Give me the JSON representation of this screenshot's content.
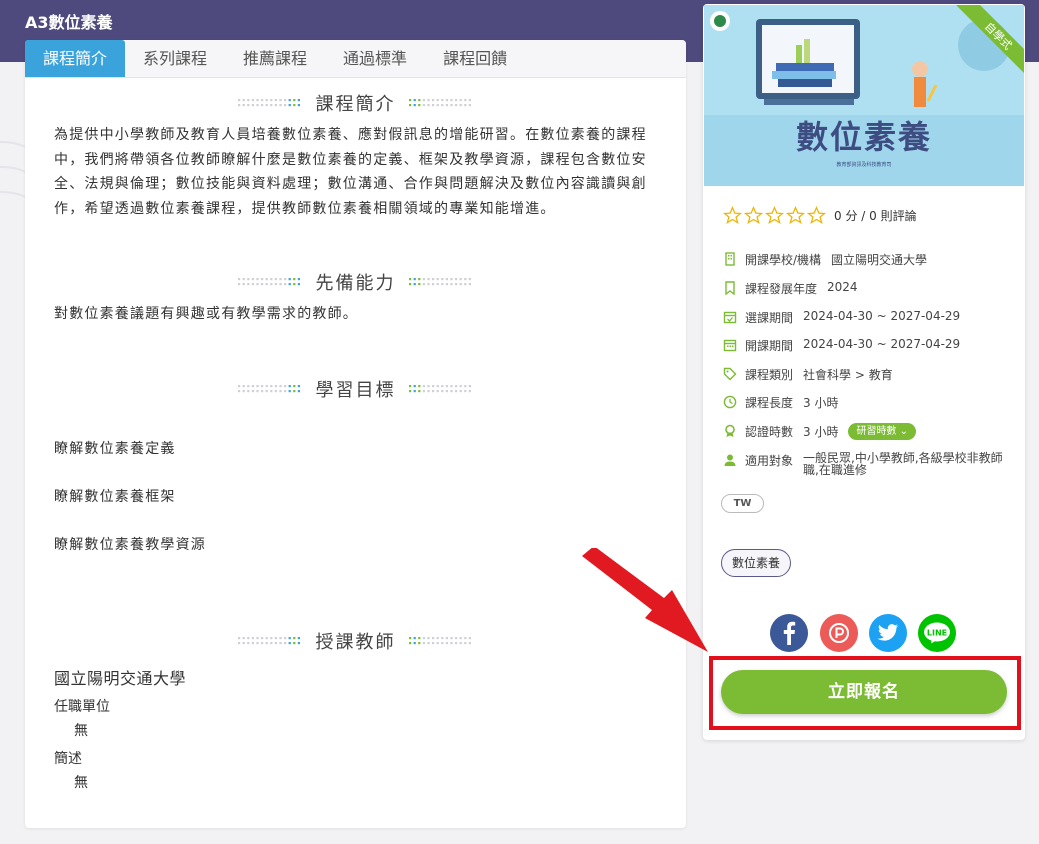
{
  "page": {
    "title": "A3數位素養"
  },
  "tabs": [
    {
      "label": "課程簡介"
    },
    {
      "label": "系列課程"
    },
    {
      "label": "推薦課程"
    },
    {
      "label": "通過標準"
    },
    {
      "label": "課程回饋"
    }
  ],
  "sections": {
    "intro": {
      "title": "課程簡介",
      "text": "為提供中小學教師及教育人員培養數位素養、應對假訊息的增能研習。在數位素養的課程中，我們將帶領各位教師瞭解什麼是數位素養的定義、框架及教學資源，課程包含數位安全、法規與倫理；數位技能與資料處理；數位溝通、合作與問題解決及數位內容識讀與創作，希望透過數位素養課程，提供教師數位素養相關領域的專業知能增進。"
    },
    "prereq": {
      "title": "先備能力",
      "text": "對數位素養議題有興趣或有教學需求的教師。"
    },
    "goals": {
      "title": "學習目標",
      "items": [
        "瞭解數位素養定義",
        "瞭解數位素養框架",
        "瞭解數位素養教學資源"
      ]
    },
    "instructor": {
      "title": "授課教師",
      "name": "國立陽明交通大學",
      "unit_label": "任職單位",
      "unit_value": "無",
      "bio_label": "簡述",
      "bio_value": "無"
    }
  },
  "course_card": {
    "banner_title": "數位素養",
    "banner_subtitle": "教育部資訊及科技教育司",
    "corner_ribbon": "自學式",
    "rating_text": "0 分 / 0 則評論",
    "stars": 0,
    "info": [
      {
        "icon": "building-icon",
        "key": "開課學校/機構",
        "value": "國立陽明交通大學"
      },
      {
        "icon": "bookmark-icon",
        "key": "課程發展年度",
        "value": "2024"
      },
      {
        "icon": "calendar-check-icon",
        "key": "選課期間",
        "value": "2024-04-30 ~ 2027-04-29"
      },
      {
        "icon": "calendar-icon",
        "key": "開課期間",
        "value": "2024-04-30 ~ 2027-04-29"
      },
      {
        "icon": "tag-icon",
        "key": "課程類別",
        "value": "社會科學 > 教育"
      },
      {
        "icon": "clock-icon",
        "key": "課程長度",
        "value": "3 小時"
      },
      {
        "icon": "award-icon",
        "key": "認證時數",
        "value": "3 小時",
        "badge": "研習時數"
      },
      {
        "icon": "user-icon",
        "key": "適用對象",
        "value": "一般民眾,中小學教師,各級學校非教師職,在職進修"
      }
    ],
    "region_pill": "TW",
    "tag": "數位素養",
    "social": [
      "facebook-icon",
      "plurk-icon",
      "twitter-icon",
      "line-icon"
    ],
    "line_label": "LINE",
    "enroll_label": "立即報名",
    "colors": {
      "accent_green": "#7cbb34",
      "tab_blue": "#3aa3dc",
      "header_purple": "#4e4a7e",
      "highlight_red": "#e3101c"
    }
  }
}
